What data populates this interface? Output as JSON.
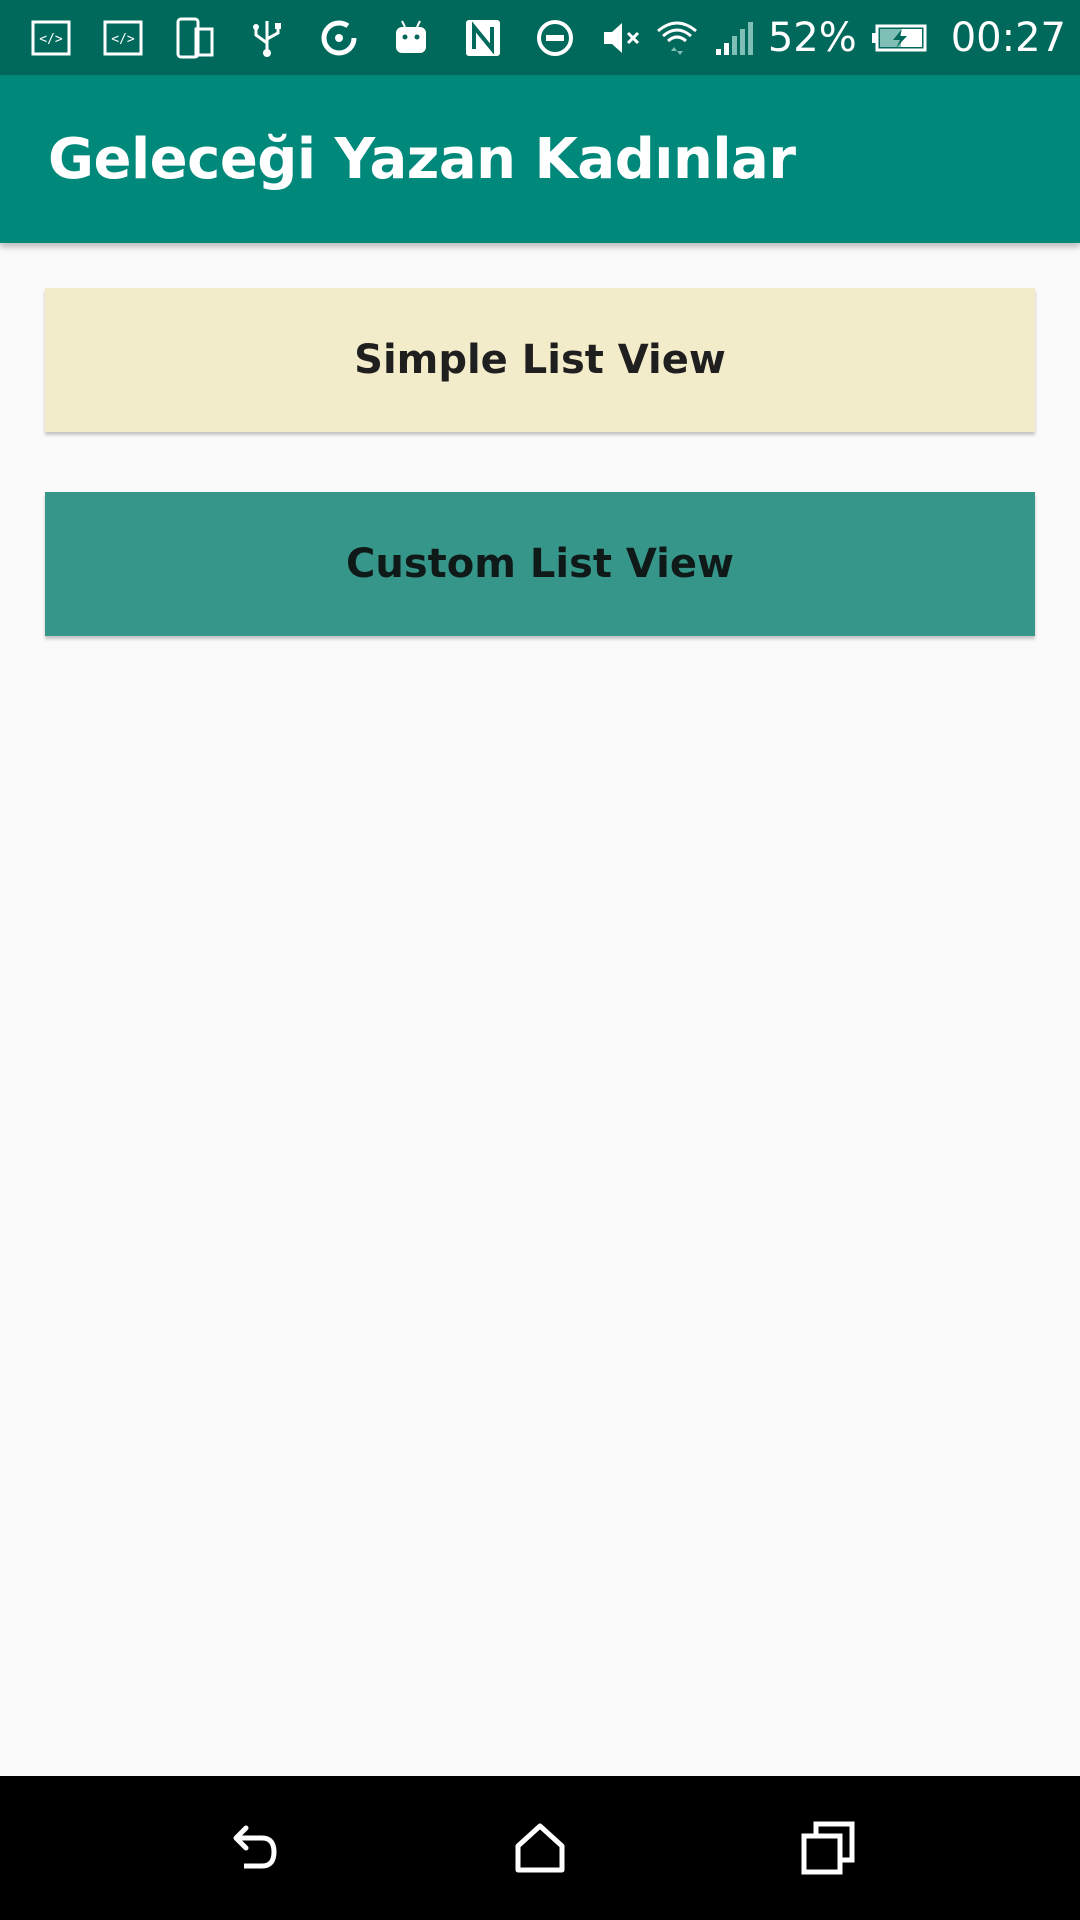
{
  "status_bar": {
    "left_icons": [
      "code-icon",
      "code-icon",
      "phone-rotate-icon",
      "usb-icon",
      "sync-icon",
      "android-icon",
      "nfc-icon",
      "do-not-disturb-icon"
    ],
    "right_icons": [
      "volume-mute-icon",
      "wifi-icon",
      "cell-signal-icon"
    ],
    "battery_percent": "52%",
    "time": "00:27"
  },
  "app_bar": {
    "title": "Geleceği Yazan Kadınlar"
  },
  "buttons": {
    "simple_list": "Simple List View",
    "custom_list": "Custom List View"
  },
  "colors": {
    "status_bar": "#00695c",
    "app_bar": "#00897b",
    "simple_button": "#f2ecca",
    "custom_button": "#37968a",
    "background": "#fafafa"
  },
  "nav_bar": {
    "icons": [
      "back-icon",
      "home-icon",
      "recents-icon"
    ]
  }
}
